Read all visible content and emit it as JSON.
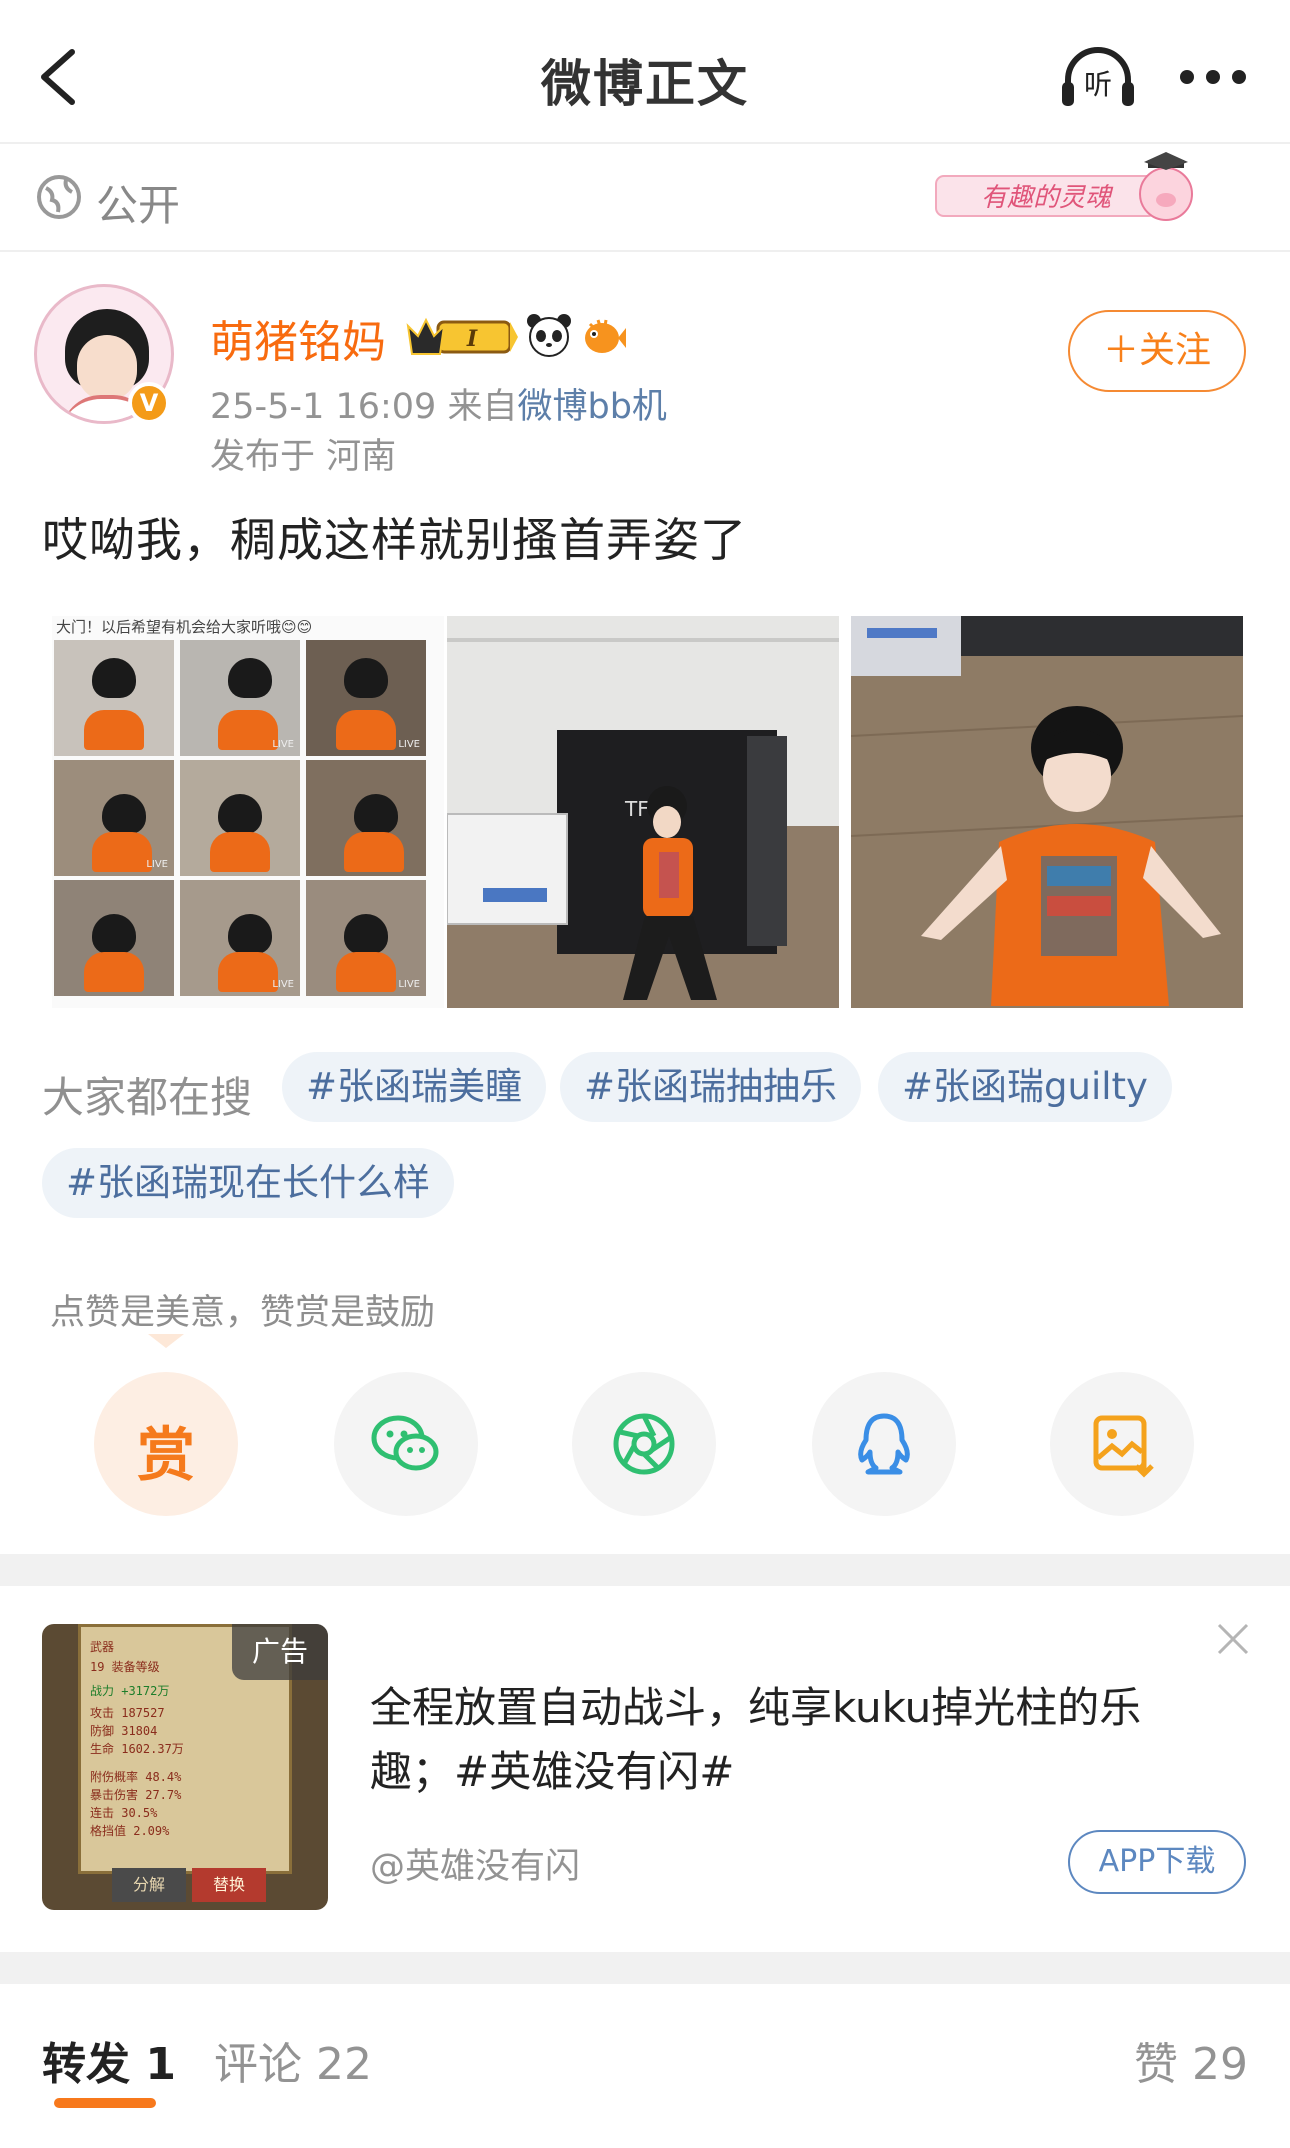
{
  "nav": {
    "title": "微博正文",
    "listen_label": "听"
  },
  "visibility": {
    "label": "公开",
    "badge_text": "有趣的灵魂"
  },
  "post": {
    "username": "萌猪铭妈",
    "vip_level": "I",
    "verified_mark": "V",
    "time": "25-5-1 16:09",
    "from_label": "来自",
    "source": "微博bb机",
    "location": "发布于 河南",
    "follow_label": "＋关注",
    "text": "哎呦我，稠成这样就别搔首弄姿了",
    "photo1_caption": "大门！以后希望有机会给大家听哦😊😊",
    "live_label": "LIVE"
  },
  "hot_search": {
    "label": "大家都在搜",
    "tags": [
      "#张函瑞美瞳",
      "#张函瑞抽抽乐",
      "#张函瑞guilty",
      "#张函瑞现在长什么样"
    ]
  },
  "share": {
    "praise_text": "点赞是美意，赞赏是鼓励",
    "reward_label": "赏",
    "buttons": [
      "reward",
      "wechat",
      "moments",
      "qq",
      "save-image"
    ]
  },
  "ad": {
    "badge": "广告",
    "text": "全程放置自动战斗，纯享kuku掉光柱的乐趣；#英雄没有闪#",
    "author": "@英雄没有闪",
    "cta": "APP下载",
    "thumb_rows": [
      "武器",
      "19 装备等级",
      "战力 +3172万",
      "攻击 187527",
      "防御 31804",
      "生命 1602.37万",
      "附伤概率 48.4%",
      "暴击伤害 27.7%",
      "连击 30.5%",
      "格挡值 2.09%"
    ],
    "thumb_btn1": "分解",
    "thumb_btn2": "替换"
  },
  "bottom_tabs": {
    "repost": "转发 1",
    "comments": "评论 22",
    "likes": "赞 29"
  },
  "colors": {
    "accent": "#f7791c",
    "link": "#5d7fa9",
    "tag_bg": "#eef3f8",
    "wechat": "#2fbf71",
    "qq": "#3a8ee6"
  }
}
